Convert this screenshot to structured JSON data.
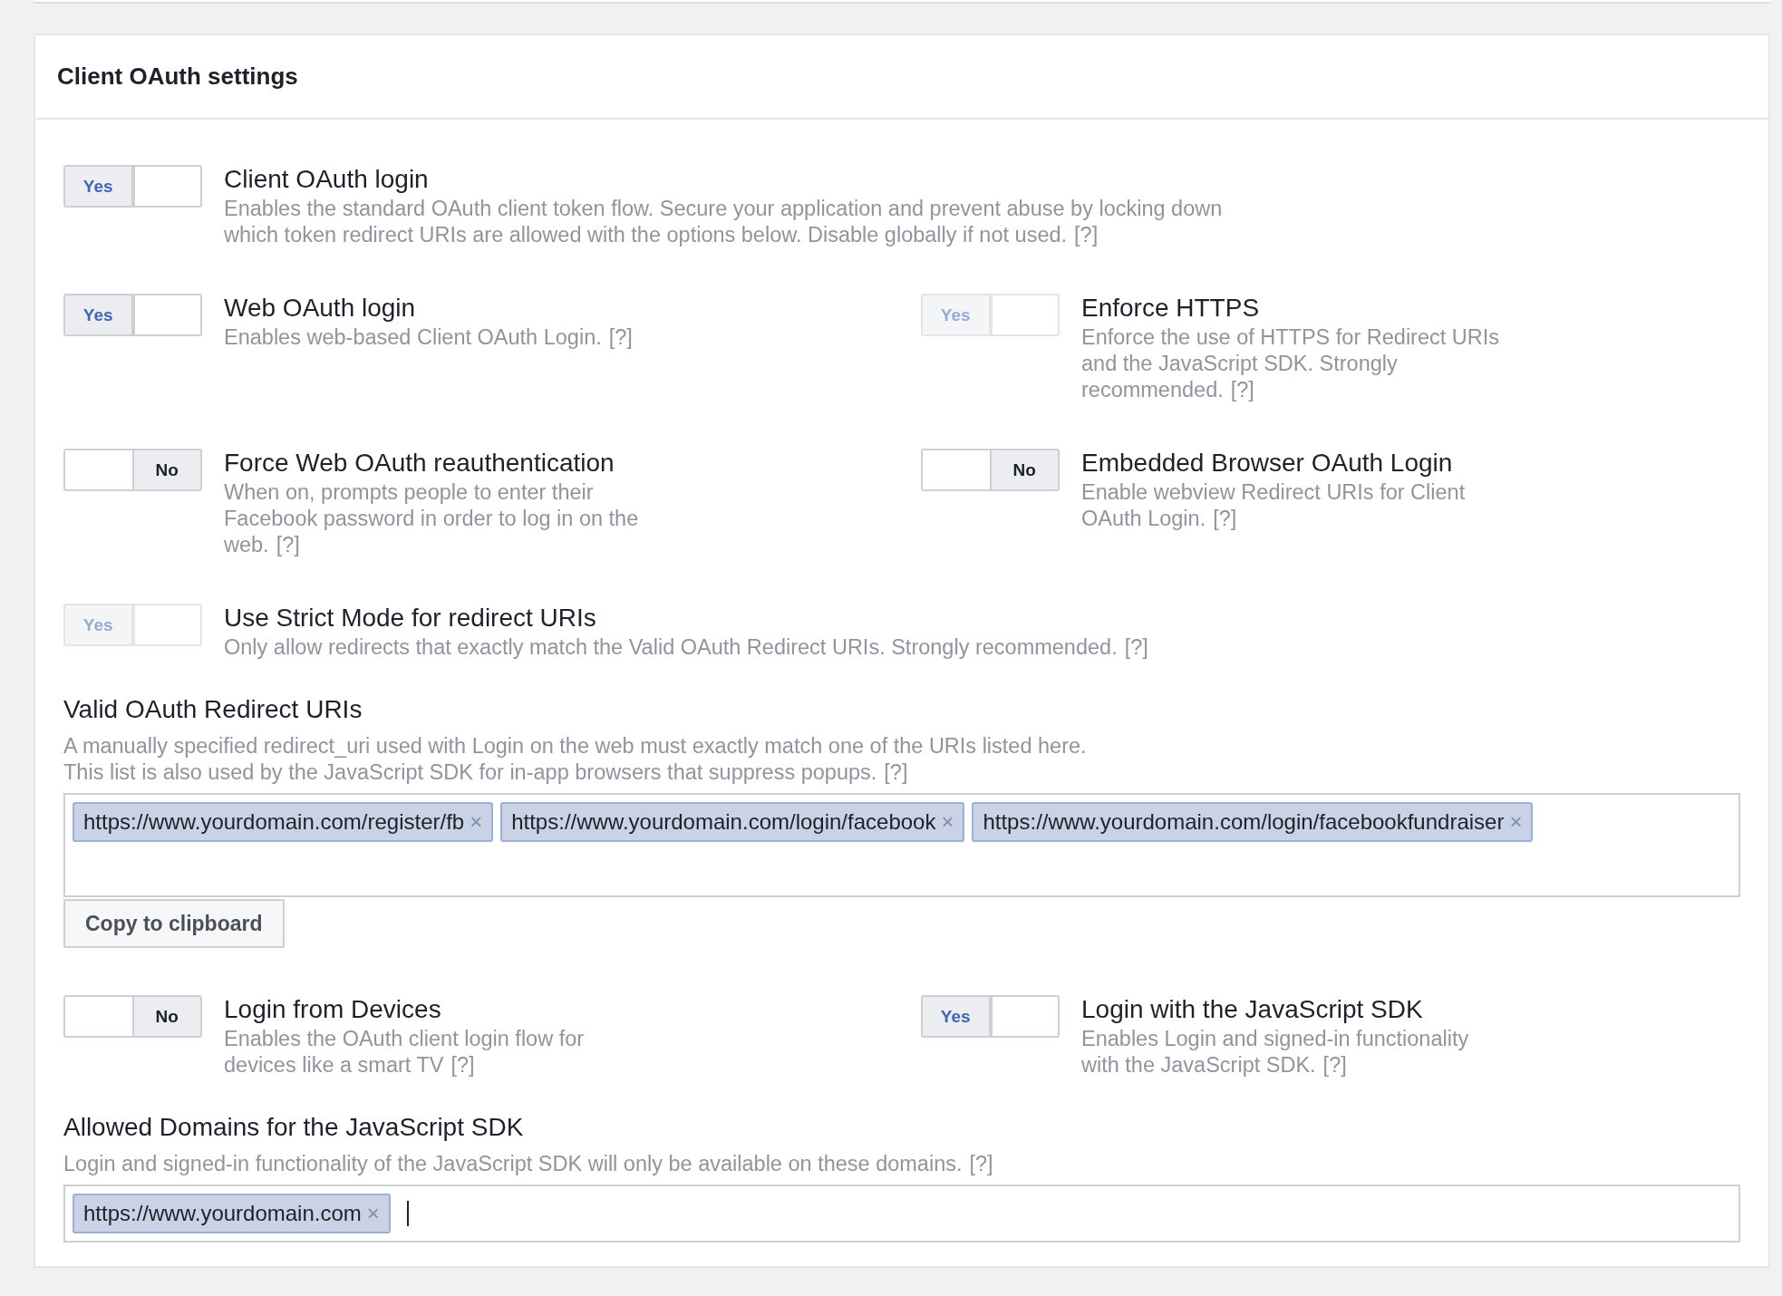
{
  "panel_title": "Client OAuth settings",
  "blocks": [
    {
      "kind": "toggles",
      "settings": [
        {
          "title": "Client OAuth login",
          "description": "Enables the standard OAuth client token flow. Secure your application and prevent abuse by locking down which token redirect URIs are allowed with the options below. Disable globally if not used.",
          "help": "[?]",
          "on": true,
          "disabled": false,
          "state_label": "Yes"
        }
      ]
    },
    {
      "kind": "toggles",
      "settings": [
        {
          "title": "Web OAuth login",
          "description": "Enables web-based Client OAuth Login.",
          "help": "[?]",
          "on": true,
          "disabled": false,
          "state_label": "Yes"
        },
        {
          "title": "Enforce HTTPS",
          "description": "Enforce the use of HTTPS for Redirect URIs and the JavaScript SDK. Strongly recommended.",
          "help": "[?]",
          "on": true,
          "disabled": true,
          "state_label": "Yes"
        }
      ]
    },
    {
      "kind": "toggles",
      "settings": [
        {
          "title": "Force Web OAuth reauthentication",
          "description": "When on, prompts people to enter their Facebook password in order to log in on the web.",
          "help": "[?]",
          "on": false,
          "disabled": false,
          "state_label": "No"
        },
        {
          "title": "Embedded Browser OAuth Login",
          "description": "Enable webview Redirect URIs for Client OAuth Login.",
          "help": "[?]",
          "on": false,
          "disabled": false,
          "state_label": "No"
        }
      ]
    },
    {
      "kind": "toggles",
      "settings": [
        {
          "title": "Use Strict Mode for redirect URIs",
          "description": "Only allow redirects that exactly match the Valid OAuth Redirect URIs. Strongly recommended.",
          "help": "[?]",
          "on": true,
          "disabled": true,
          "state_label": "Yes"
        }
      ]
    },
    {
      "kind": "tag_field",
      "label": "Valid OAuth Redirect URIs",
      "description": "A manually specified redirect_uri used with Login on the web must exactly match one of the URIs listed here. This list is also used by the JavaScript SDK for in-app browsers that suppress popups.",
      "help": "[?]",
      "focused": false,
      "tags": [
        {
          "text": "https://www.yourdomain.com/register/fb",
          "remove": "×"
        },
        {
          "text": "https://www.yourdomain.com/login/facebook",
          "remove": "×"
        },
        {
          "text": "https://www.yourdomain.com/login/facebookfundraiser",
          "remove": "×"
        }
      ],
      "button": "Copy to clipboard"
    },
    {
      "kind": "toggles",
      "settings": [
        {
          "title": "Login from Devices",
          "description": "Enables the OAuth client login flow for devices like a smart TV",
          "help": "[?]",
          "on": false,
          "disabled": false,
          "state_label": "No"
        },
        {
          "title": "Login with the JavaScript SDK",
          "description": "Enables Login and signed-in functionality with the JavaScript SDK.",
          "help": "[?]",
          "on": true,
          "disabled": false,
          "state_label": "Yes"
        }
      ]
    },
    {
      "kind": "tag_field",
      "label": "Allowed Domains for the JavaScript SDK",
      "description": "Login and signed-in functionality of the JavaScript SDK will only be available on these domains.",
      "help": "[?]",
      "focused": true,
      "tags": [
        {
          "text": "https://www.yourdomain.com",
          "remove": "×"
        }
      ]
    }
  ]
}
